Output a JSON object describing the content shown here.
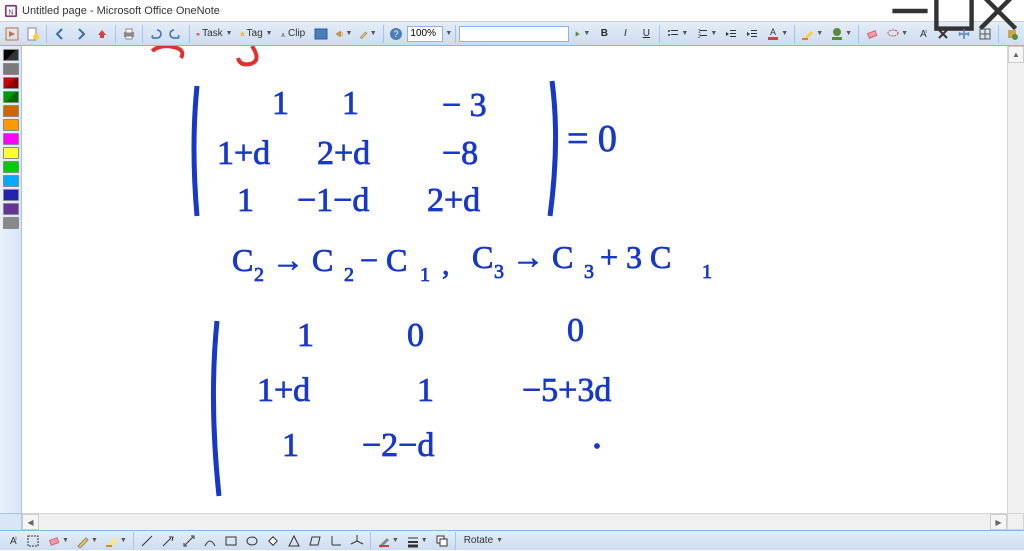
{
  "titlebar": {
    "title": "Untitled page - Microsoft Office OneNote"
  },
  "toolbar": {
    "task_label": "Task",
    "tag_label": "Tag",
    "clip_label": "Clip",
    "zoom": "100%",
    "search_value": ""
  },
  "pen_colors": [
    "#000000",
    "#7a7a7a",
    "#cc0000",
    "#009900",
    "#cc6600",
    "#ff9900",
    "#ff00ff",
    "#ffff33",
    "#00cc00",
    "#00aaff",
    "#2222aa",
    "#663399",
    "#888888"
  ],
  "bottom": {
    "rotate_label": "Rotate"
  },
  "canvas_note": "Handwritten math: determinant with rows [1,1,-3],[1+d,2+d,-8],[1,-1-d,2+d] = 0; column ops C2→C2−C1, C3→C3+3C1; resulting matrix [1,0,0],[1+d,1,-5+3d],[1,-2-d, …]"
}
